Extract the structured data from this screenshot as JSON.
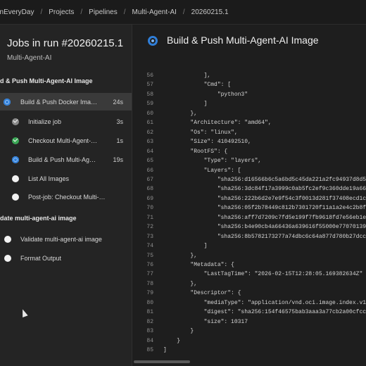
{
  "breadcrumb": [
    "onEveryDay",
    "Projects",
    "Pipelines",
    "Multi-Agent-AI",
    "20260215.1"
  ],
  "left": {
    "title": "Jobs in run #20260215.1",
    "subtitle": "Multi-Agent-AI",
    "stages": [
      {
        "label": "d & Push Multi-Agent-AI Image"
      },
      {
        "label": "date multi-agent-ai image"
      }
    ],
    "steps": [
      {
        "label": "Build & Push Docker Ima…",
        "duration": "24s",
        "status": "running",
        "icon": "running-icon"
      },
      {
        "label": "Initialize job",
        "duration": "3s",
        "status": "succeeded",
        "icon": "check-icon"
      },
      {
        "label": "Checkout Multi-Agent-…",
        "duration": "1s",
        "status": "succeeded",
        "icon": "success-check-icon"
      },
      {
        "label": "Build & Push Multi-Ag…",
        "duration": "19s",
        "status": "running",
        "icon": "running-icon"
      },
      {
        "label": "List All Images",
        "duration": "",
        "status": "pending",
        "icon": "pending-icon"
      },
      {
        "label": "Post-job: Checkout Multi-…",
        "duration": "",
        "status": "pending",
        "icon": "pending-icon"
      },
      {
        "label": "Validate multi-agent-ai image",
        "duration": "",
        "status": "pending",
        "icon": "pending-icon"
      },
      {
        "label": "Format Output",
        "duration": "",
        "status": "pending",
        "icon": "pending-icon"
      }
    ]
  },
  "right": {
    "title": "Build & Push Multi-Agent-AI Image",
    "lines": [
      {
        "n": "56",
        "t": "            ],"
      },
      {
        "n": "57",
        "t": "            \"Cmd\": ["
      },
      {
        "n": "58",
        "t": "                \"python3\""
      },
      {
        "n": "59",
        "t": "            ]"
      },
      {
        "n": "60",
        "t": "        },"
      },
      {
        "n": "61",
        "t": "        \"Architecture\": \"amd64\","
      },
      {
        "n": "62",
        "t": "        \"Os\": \"linux\","
      },
      {
        "n": "63",
        "t": "        \"Size\": 410492510,"
      },
      {
        "n": "64",
        "t": "        \"RootFS\": {"
      },
      {
        "n": "65",
        "t": "            \"Type\": \"layers\","
      },
      {
        "n": "66",
        "t": "            \"Layers\": ["
      },
      {
        "n": "67",
        "t": "                \"sha256:d16566b6c5a6bd5c45da221a2fc94937d8d50"
      },
      {
        "n": "68",
        "t": "                \"sha256:3dc84f17a3999c0ab5fc2ef9c360dde19a663"
      },
      {
        "n": "69",
        "t": "                \"sha256:222b6d2e7e9f54c3f0013d281f37408ecd1c6"
      },
      {
        "n": "70",
        "t": "                \"sha256:05f2b78449c812b7301720f11a1a2e4c2b8fc"
      },
      {
        "n": "71",
        "t": "                \"sha256:aff7d7209c7fd5e199f7fb9618fd7e56eb1ee"
      },
      {
        "n": "72",
        "t": "                \"sha256:b4e90cb4a66436a639616f55000e77070139"
      },
      {
        "n": "73",
        "t": "                \"sha256:8b5782173277a74dbc6c64a877d780b27dcc9"
      },
      {
        "n": "74",
        "t": "            ]"
      },
      {
        "n": "75",
        "t": "        },"
      },
      {
        "n": "76",
        "t": "        \"Metadata\": {"
      },
      {
        "n": "77",
        "t": "            \"LastTagTime\": \"2026-02-15T12:28:05.169382634Z\""
      },
      {
        "n": "78",
        "t": "        },"
      },
      {
        "n": "79",
        "t": "        \"Descriptor\": {"
      },
      {
        "n": "80",
        "t": "            \"mediaType\": \"application/vnd.oci.image.index.v1+"
      },
      {
        "n": "81",
        "t": "            \"digest\": \"sha256:154f46575bab3aaa3a77cb2a00cfcc1"
      },
      {
        "n": "82",
        "t": "            \"size\": 10317"
      },
      {
        "n": "83",
        "t": "        }"
      },
      {
        "n": "84",
        "t": "    }"
      },
      {
        "n": "85",
        "t": "]"
      }
    ]
  },
  "colors": {
    "accent": "#2f7ed8",
    "success": "#3aa655",
    "selected_bg": "#3a3a3a"
  }
}
